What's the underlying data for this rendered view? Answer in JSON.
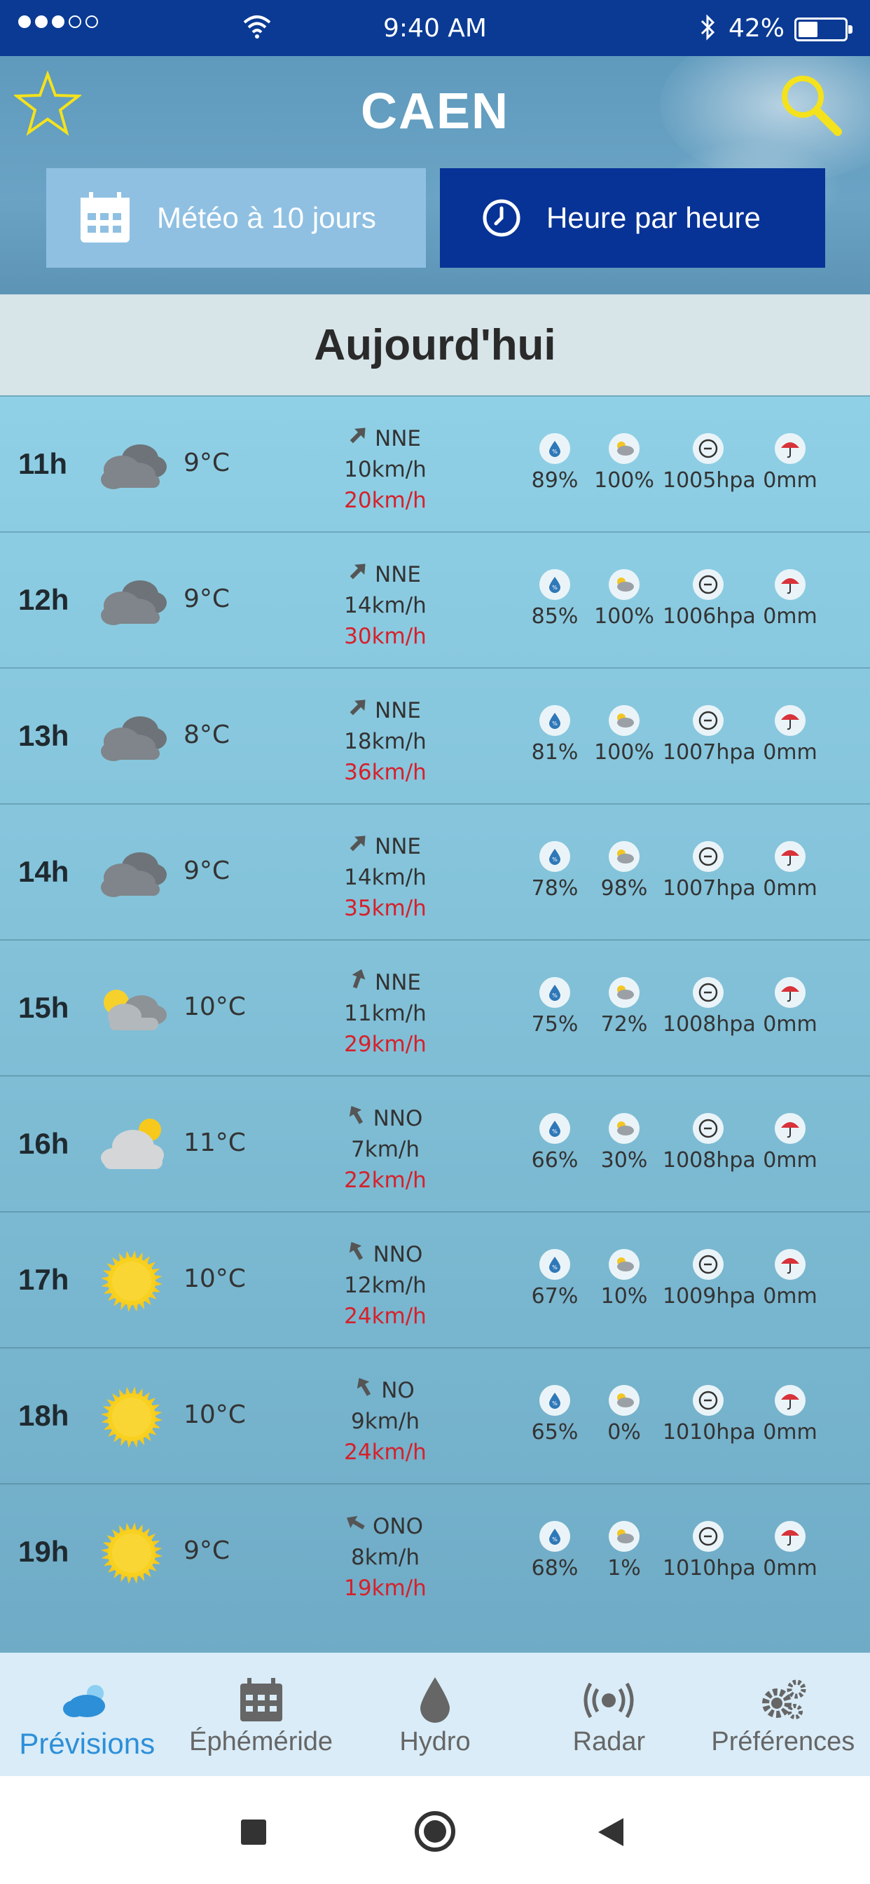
{
  "status_bar": {
    "time": "9:40 AM",
    "battery": "42%",
    "battery_level": 0.42
  },
  "header": {
    "city": "CAEN",
    "btn_10days": "Météo à 10 jours",
    "btn_hourly": "Heure par heure"
  },
  "day_label": "Aujourd'hui",
  "colors": {
    "nav_active": "#2d8fd8",
    "gust": "#d6202a",
    "hourly_active": "#073397",
    "status_bar": "#0a3a94"
  },
  "rows": [
    {
      "hour": "11h",
      "icon": "cloudy-icon",
      "temp": "9°C",
      "dir": "NNE",
      "arrow": "arrow-sw",
      "speed": "10km/h",
      "gust": "20km/h",
      "humidity": "89%",
      "cloud": "100%",
      "pressure": "1005hpa",
      "rain": "0mm"
    },
    {
      "hour": "12h",
      "icon": "cloudy-icon",
      "temp": "9°C",
      "dir": "NNE",
      "arrow": "arrow-sw",
      "speed": "14km/h",
      "gust": "30km/h",
      "humidity": "85%",
      "cloud": "100%",
      "pressure": "1006hpa",
      "rain": "0mm"
    },
    {
      "hour": "13h",
      "icon": "cloudy-icon",
      "temp": "8°C",
      "dir": "NNE",
      "arrow": "arrow-sw",
      "speed": "18km/h",
      "gust": "36km/h",
      "humidity": "81%",
      "cloud": "100%",
      "pressure": "1007hpa",
      "rain": "0mm"
    },
    {
      "hour": "14h",
      "icon": "cloudy-icon",
      "temp": "9°C",
      "dir": "NNE",
      "arrow": "arrow-sw",
      "speed": "14km/h",
      "gust": "35km/h",
      "humidity": "78%",
      "cloud": "98%",
      "pressure": "1007hpa",
      "rain": "0mm"
    },
    {
      "hour": "15h",
      "icon": "partly-cloudy-icon",
      "temp": "10°C",
      "dir": "NNE",
      "arrow": "arrow-s",
      "speed": "11km/h",
      "gust": "29km/h",
      "humidity": "75%",
      "cloud": "72%",
      "pressure": "1008hpa",
      "rain": "0mm"
    },
    {
      "hour": "16h",
      "icon": "mostly-cloudy-sun-icon",
      "temp": "11°C",
      "dir": "NNO",
      "arrow": "arrow-se",
      "speed": "7km/h",
      "gust": "22km/h",
      "humidity": "66%",
      "cloud": "30%",
      "pressure": "1008hpa",
      "rain": "0mm"
    },
    {
      "hour": "17h",
      "icon": "sun-icon",
      "temp": "10°C",
      "dir": "NNO",
      "arrow": "arrow-se",
      "speed": "12km/h",
      "gust": "24km/h",
      "humidity": "67%",
      "cloud": "10%",
      "pressure": "1009hpa",
      "rain": "0mm"
    },
    {
      "hour": "18h",
      "icon": "sun-icon",
      "temp": "10°C",
      "dir": "NO",
      "arrow": "arrow-se",
      "speed": "9km/h",
      "gust": "24km/h",
      "humidity": "65%",
      "cloud": "0%",
      "pressure": "1010hpa",
      "rain": "0mm"
    },
    {
      "hour": "19h",
      "icon": "sun-icon",
      "temp": "9°C",
      "dir": "ONO",
      "arrow": "arrow-e",
      "speed": "8km/h",
      "gust": "19km/h",
      "humidity": "68%",
      "cloud": "1%",
      "pressure": "1010hpa",
      "rain": "0mm"
    }
  ],
  "bottom_nav": [
    {
      "label": "Prévisions",
      "icon": "cloud-sun-icon",
      "active": true
    },
    {
      "label": "Éphéméride",
      "icon": "calendar-icon",
      "active": false
    },
    {
      "label": "Hydro",
      "icon": "drop-icon",
      "active": false
    },
    {
      "label": "Radar",
      "icon": "radar-icon",
      "active": false
    },
    {
      "label": "Préférences",
      "icon": "gears-icon",
      "active": false
    }
  ]
}
